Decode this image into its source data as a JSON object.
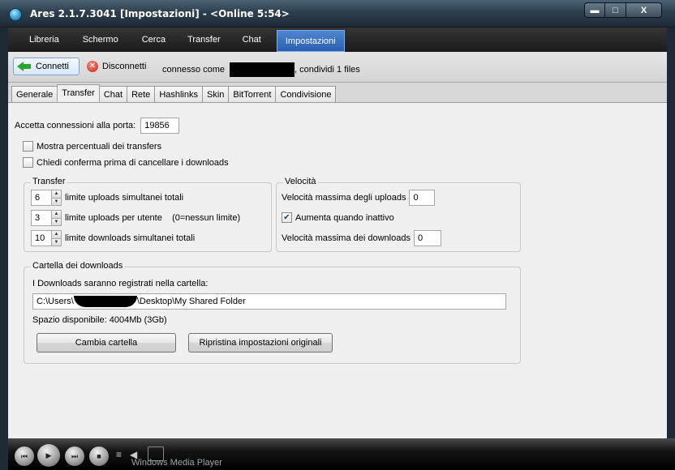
{
  "window": {
    "title": "Ares 2.1.7.3041  [Impostazioni]  - <Online 5:54>",
    "min_glyph": "▬",
    "max_glyph": "□",
    "close_glyph": "X"
  },
  "menu": {
    "items": [
      "Libreria",
      "Schermo",
      "Cerca",
      "Transfer",
      "Chat",
      "Impostazioni"
    ],
    "active": "Impostazioni"
  },
  "connection": {
    "connect_label": "Connetti",
    "disconnect_label": "Disconnetti",
    "connected_as_label": "connesso come",
    "share_text": ", condividi 1 files"
  },
  "tabs": {
    "items": [
      "Generale",
      "Transfer",
      "Chat",
      "Rete",
      "Hashlinks",
      "Skin",
      "BitTorrent",
      "Condivisione"
    ],
    "active": "Transfer"
  },
  "settings": {
    "port_label": "Accetta connessioni alla porta:",
    "port_value": "19856",
    "show_percent_label": "Mostra percentuali dei transfers",
    "show_percent_checked": false,
    "confirm_cancel_label": "Chiedi conferma prima di cancellare i downloads",
    "confirm_cancel_checked": false
  },
  "transfer_group": {
    "legend": "Transfer",
    "uploads_total_value": "6",
    "uploads_total_label": "limite uploads simultanei totali",
    "uploads_user_value": "3",
    "uploads_user_label": "limite uploads per utente    (0=nessun limite)",
    "downloads_total_value": "10",
    "downloads_total_label": "limite downloads simultanei totali"
  },
  "speed_group": {
    "legend": "Velocità",
    "max_upload_label": "Velocità massima degli uploads",
    "max_upload_value": "0",
    "increase_idle_label": "Aumenta quando inattivo",
    "increase_idle_checked": true,
    "max_download_label": "Velocità massima dei downloads",
    "max_download_value": "0"
  },
  "download_folder": {
    "legend": "Cartella dei downloads",
    "description": "I Downloads saranno registrati nella cartella:",
    "path_prefix": "C:\\Users\\",
    "path_suffix": "\\Desktop\\My Shared Folder",
    "space_text": "Spazio disponibile: 4004Mb (3Gb)",
    "change_button": "Cambia cartella",
    "reset_button": "Ripristina impostazioni originali"
  },
  "player": {
    "label": "Windows Media Player"
  },
  "colors": {
    "menu_active": "#3a73c4",
    "content_bg": "#f0f0f0",
    "checkbox_mark": "#1a3d7a"
  }
}
